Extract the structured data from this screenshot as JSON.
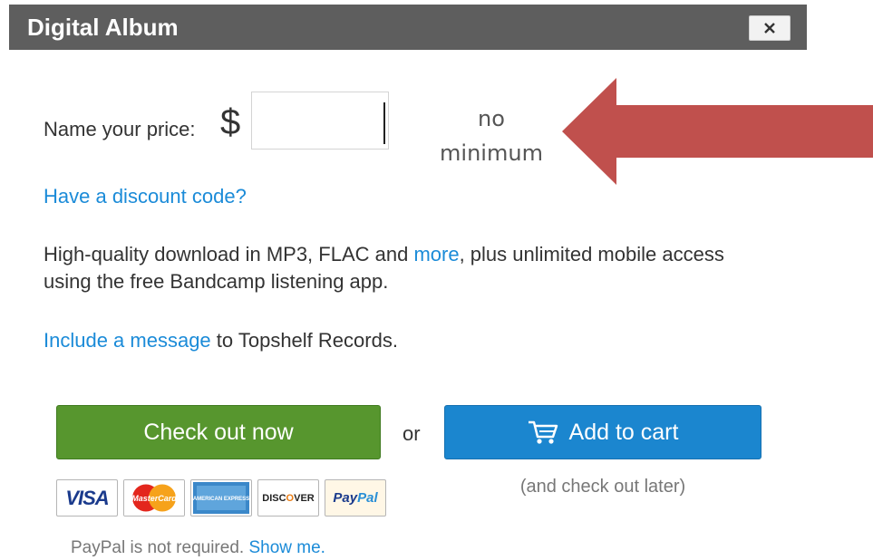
{
  "dialog": {
    "title": "Digital Album",
    "close_symbol": "✕"
  },
  "price": {
    "label": "Name your price:",
    "currency_symbol": "$",
    "input_value": "",
    "note_line1": "no",
    "note_line2": "minimum"
  },
  "discount_link": "Have a discount code?",
  "description": {
    "part1": "High-quality download in MP3, FLAC and ",
    "link": "more",
    "part2": ", plus unlimited mobile access using the free Bandcamp listening app."
  },
  "message": {
    "link": "Include a message",
    "suffix": " to Topshelf Records."
  },
  "buttons": {
    "checkout": "Check out now",
    "or": "or",
    "add_to_cart": "Add to cart",
    "cart_note": "(and check out later)"
  },
  "payment_cards": {
    "visa": "VISA",
    "mastercard": "MasterCard",
    "amex": "AMERICAN EXPRESS",
    "discover_pre": "DISC",
    "discover_o": "O",
    "discover_post": "VER",
    "paypal_pay": "Pay",
    "paypal_pal": "Pal"
  },
  "paypal_note": {
    "text": "PayPal is not required. ",
    "link": "Show me."
  },
  "colors": {
    "titlebar": "#5e5e5e",
    "link": "#1b8bd8",
    "checkout_green": "#57962e",
    "cart_blue": "#1b86cf",
    "arrow_red": "#c0504d"
  },
  "icons": [
    "close-icon",
    "cart-icon",
    "arrow-icon"
  ]
}
